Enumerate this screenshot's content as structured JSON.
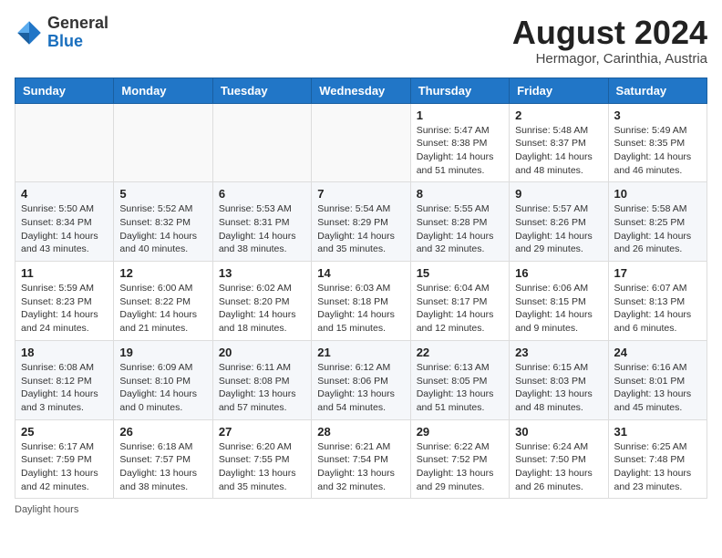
{
  "header": {
    "logo_general": "General",
    "logo_blue": "Blue",
    "month_year": "August 2024",
    "location": "Hermagor, Carinthia, Austria"
  },
  "days_of_week": [
    "Sunday",
    "Monday",
    "Tuesday",
    "Wednesday",
    "Thursday",
    "Friday",
    "Saturday"
  ],
  "weeks": [
    [
      {
        "day": "",
        "info": ""
      },
      {
        "day": "",
        "info": ""
      },
      {
        "day": "",
        "info": ""
      },
      {
        "day": "",
        "info": ""
      },
      {
        "day": "1",
        "info": "Sunrise: 5:47 AM\nSunset: 8:38 PM\nDaylight: 14 hours and 51 minutes."
      },
      {
        "day": "2",
        "info": "Sunrise: 5:48 AM\nSunset: 8:37 PM\nDaylight: 14 hours and 48 minutes."
      },
      {
        "day": "3",
        "info": "Sunrise: 5:49 AM\nSunset: 8:35 PM\nDaylight: 14 hours and 46 minutes."
      }
    ],
    [
      {
        "day": "4",
        "info": "Sunrise: 5:50 AM\nSunset: 8:34 PM\nDaylight: 14 hours and 43 minutes."
      },
      {
        "day": "5",
        "info": "Sunrise: 5:52 AM\nSunset: 8:32 PM\nDaylight: 14 hours and 40 minutes."
      },
      {
        "day": "6",
        "info": "Sunrise: 5:53 AM\nSunset: 8:31 PM\nDaylight: 14 hours and 38 minutes."
      },
      {
        "day": "7",
        "info": "Sunrise: 5:54 AM\nSunset: 8:29 PM\nDaylight: 14 hours and 35 minutes."
      },
      {
        "day": "8",
        "info": "Sunrise: 5:55 AM\nSunset: 8:28 PM\nDaylight: 14 hours and 32 minutes."
      },
      {
        "day": "9",
        "info": "Sunrise: 5:57 AM\nSunset: 8:26 PM\nDaylight: 14 hours and 29 minutes."
      },
      {
        "day": "10",
        "info": "Sunrise: 5:58 AM\nSunset: 8:25 PM\nDaylight: 14 hours and 26 minutes."
      }
    ],
    [
      {
        "day": "11",
        "info": "Sunrise: 5:59 AM\nSunset: 8:23 PM\nDaylight: 14 hours and 24 minutes."
      },
      {
        "day": "12",
        "info": "Sunrise: 6:00 AM\nSunset: 8:22 PM\nDaylight: 14 hours and 21 minutes."
      },
      {
        "day": "13",
        "info": "Sunrise: 6:02 AM\nSunset: 8:20 PM\nDaylight: 14 hours and 18 minutes."
      },
      {
        "day": "14",
        "info": "Sunrise: 6:03 AM\nSunset: 8:18 PM\nDaylight: 14 hours and 15 minutes."
      },
      {
        "day": "15",
        "info": "Sunrise: 6:04 AM\nSunset: 8:17 PM\nDaylight: 14 hours and 12 minutes."
      },
      {
        "day": "16",
        "info": "Sunrise: 6:06 AM\nSunset: 8:15 PM\nDaylight: 14 hours and 9 minutes."
      },
      {
        "day": "17",
        "info": "Sunrise: 6:07 AM\nSunset: 8:13 PM\nDaylight: 14 hours and 6 minutes."
      }
    ],
    [
      {
        "day": "18",
        "info": "Sunrise: 6:08 AM\nSunset: 8:12 PM\nDaylight: 14 hours and 3 minutes."
      },
      {
        "day": "19",
        "info": "Sunrise: 6:09 AM\nSunset: 8:10 PM\nDaylight: 14 hours and 0 minutes."
      },
      {
        "day": "20",
        "info": "Sunrise: 6:11 AM\nSunset: 8:08 PM\nDaylight: 13 hours and 57 minutes."
      },
      {
        "day": "21",
        "info": "Sunrise: 6:12 AM\nSunset: 8:06 PM\nDaylight: 13 hours and 54 minutes."
      },
      {
        "day": "22",
        "info": "Sunrise: 6:13 AM\nSunset: 8:05 PM\nDaylight: 13 hours and 51 minutes."
      },
      {
        "day": "23",
        "info": "Sunrise: 6:15 AM\nSunset: 8:03 PM\nDaylight: 13 hours and 48 minutes."
      },
      {
        "day": "24",
        "info": "Sunrise: 6:16 AM\nSunset: 8:01 PM\nDaylight: 13 hours and 45 minutes."
      }
    ],
    [
      {
        "day": "25",
        "info": "Sunrise: 6:17 AM\nSunset: 7:59 PM\nDaylight: 13 hours and 42 minutes."
      },
      {
        "day": "26",
        "info": "Sunrise: 6:18 AM\nSunset: 7:57 PM\nDaylight: 13 hours and 38 minutes."
      },
      {
        "day": "27",
        "info": "Sunrise: 6:20 AM\nSunset: 7:55 PM\nDaylight: 13 hours and 35 minutes."
      },
      {
        "day": "28",
        "info": "Sunrise: 6:21 AM\nSunset: 7:54 PM\nDaylight: 13 hours and 32 minutes."
      },
      {
        "day": "29",
        "info": "Sunrise: 6:22 AM\nSunset: 7:52 PM\nDaylight: 13 hours and 29 minutes."
      },
      {
        "day": "30",
        "info": "Sunrise: 6:24 AM\nSunset: 7:50 PM\nDaylight: 13 hours and 26 minutes."
      },
      {
        "day": "31",
        "info": "Sunrise: 6:25 AM\nSunset: 7:48 PM\nDaylight: 13 hours and 23 minutes."
      }
    ]
  ],
  "footer": {
    "daylight_label": "Daylight hours"
  }
}
